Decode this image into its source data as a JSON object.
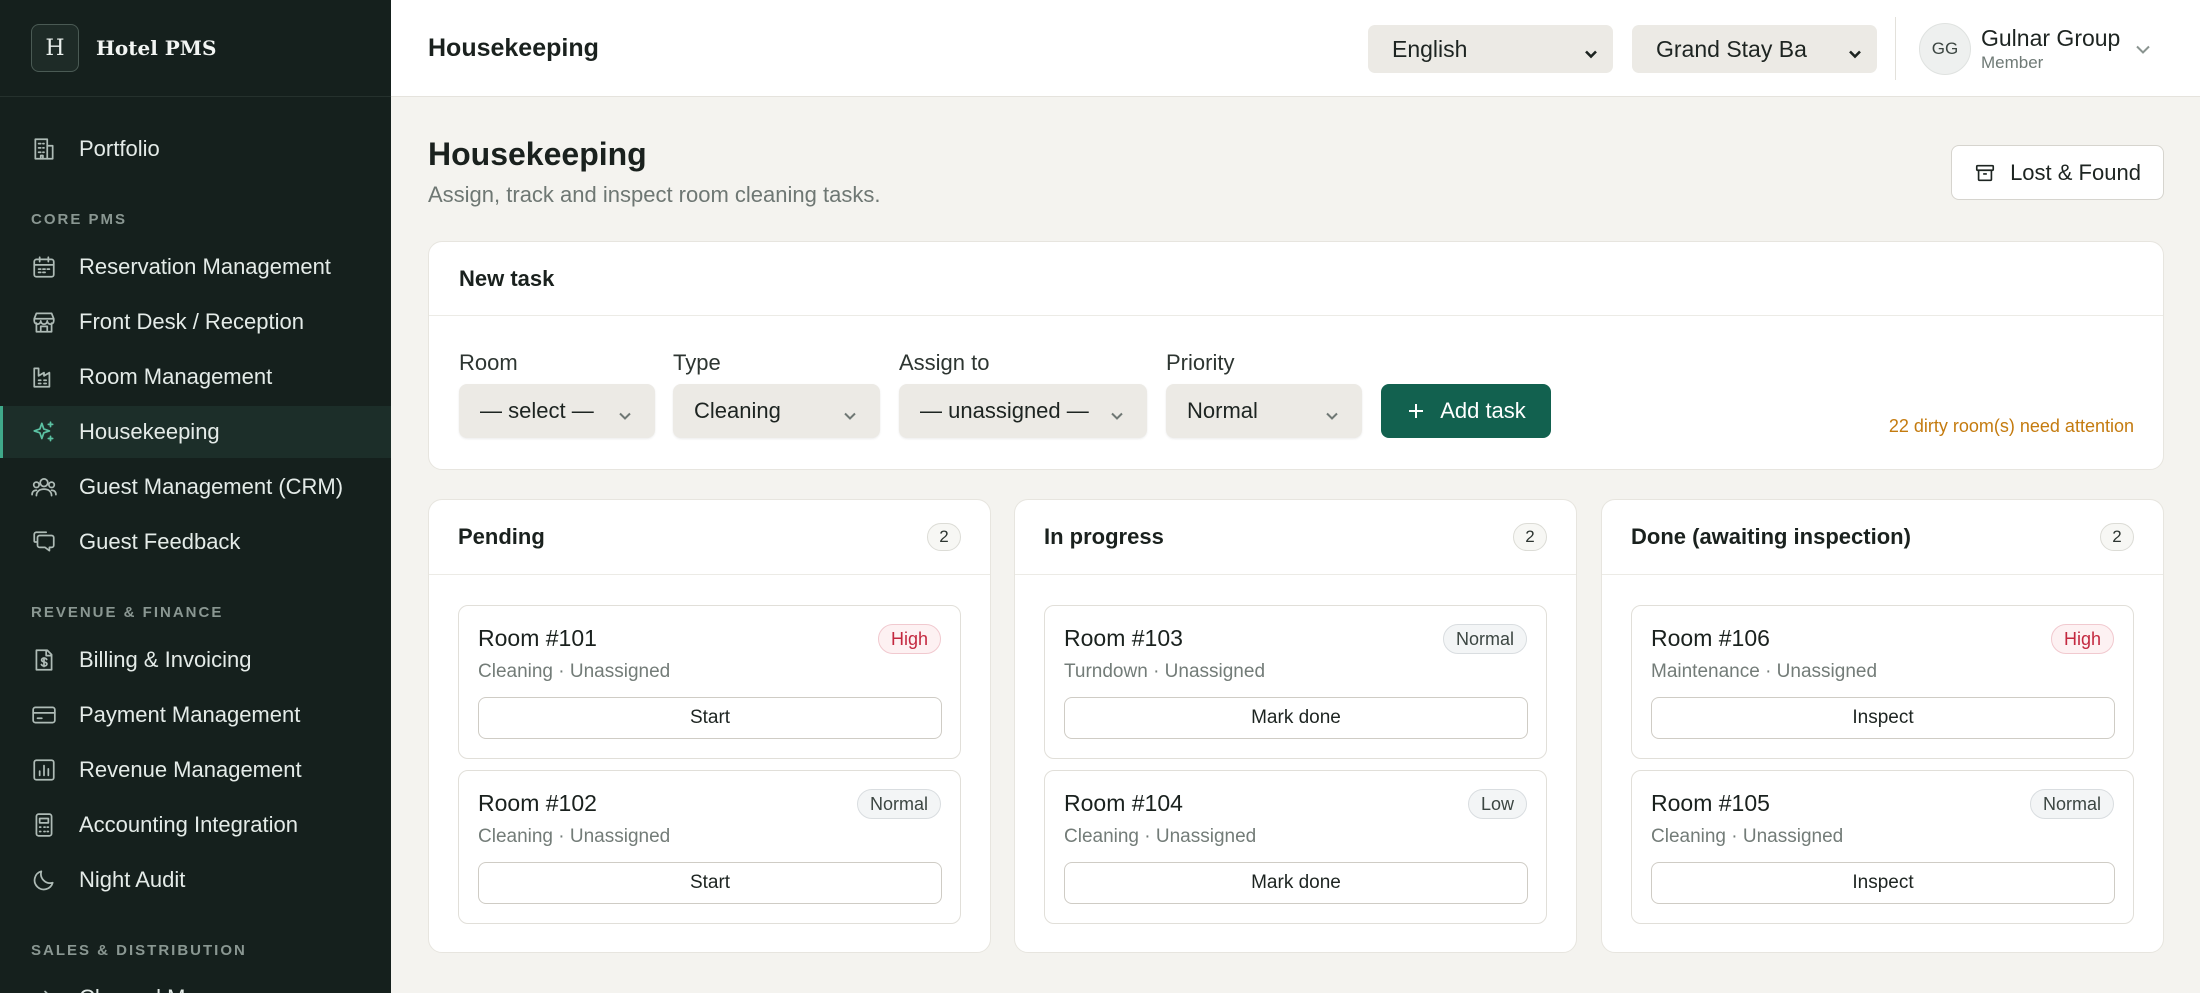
{
  "app": {
    "logo_letter": "H",
    "name": "Hotel PMS"
  },
  "sidebar": {
    "top_item": {
      "label": "Portfolio",
      "icon": "building-icon"
    },
    "sections": [
      {
        "title": "CORE PMS"
      },
      {
        "title": "REVENUE & FINANCE"
      },
      {
        "title": "SALES & DISTRIBUTION"
      }
    ],
    "items": [
      {
        "label": "Reservation Management",
        "icon": "calendar-icon"
      },
      {
        "label": "Front Desk / Reception",
        "icon": "store-icon"
      },
      {
        "label": "Room Management",
        "icon": "factory-icon"
      },
      {
        "label": "Housekeeping",
        "icon": "sparkles-icon",
        "active": true
      },
      {
        "label": "Guest Management (CRM)",
        "icon": "users-icon"
      },
      {
        "label": "Guest Feedback",
        "icon": "message-icon"
      },
      {
        "label": "Billing & Invoicing",
        "icon": "receipt-icon"
      },
      {
        "label": "Payment Management",
        "icon": "credit-card-icon"
      },
      {
        "label": "Revenue Management",
        "icon": "bar-chart-icon"
      },
      {
        "label": "Accounting Integration",
        "icon": "calculator-icon"
      },
      {
        "label": "Night Audit",
        "icon": "moon-icon"
      },
      {
        "label": "Channel Manager",
        "icon": "arrow-icon"
      }
    ]
  },
  "topbar": {
    "title": "Housekeeping",
    "language": "English",
    "property": "Grand Stay Bal",
    "user": {
      "initials": "GG",
      "name": "Gulnar Group",
      "role": "Member"
    }
  },
  "page": {
    "title": "Housekeeping",
    "subtitle": "Assign, track and inspect room cleaning tasks.",
    "lost_found_label": "Lost & Found"
  },
  "new_task": {
    "title": "New task",
    "fields": {
      "room": {
        "label": "Room",
        "value": "— select —"
      },
      "type": {
        "label": "Type",
        "value": "Cleaning"
      },
      "assign": {
        "label": "Assign to",
        "value": "— unassigned —"
      },
      "priority": {
        "label": "Priority",
        "value": "Normal"
      }
    },
    "add_label": "Add task",
    "attention": "22 dirty room(s) need attention"
  },
  "columns": [
    {
      "title": "Pending",
      "count": "2",
      "tasks": [
        {
          "room": "Room #101",
          "meta": "Cleaning · Unassigned",
          "priority": "High",
          "level": "high",
          "action": "Start"
        },
        {
          "room": "Room #102",
          "meta": "Cleaning · Unassigned",
          "priority": "Normal",
          "level": "normal",
          "action": "Start"
        }
      ]
    },
    {
      "title": "In progress",
      "count": "2",
      "tasks": [
        {
          "room": "Room #103",
          "meta": "Turndown · Unassigned",
          "priority": "Normal",
          "level": "normal",
          "action": "Mark done"
        },
        {
          "room": "Room #104",
          "meta": "Cleaning · Unassigned",
          "priority": "Low",
          "level": "low",
          "action": "Mark done"
        }
      ]
    },
    {
      "title": "Done (awaiting inspection)",
      "count": "2",
      "tasks": [
        {
          "room": "Room #106",
          "meta": "Maintenance · Unassigned",
          "priority": "High",
          "level": "high",
          "action": "Inspect"
        },
        {
          "room": "Room #105",
          "meta": "Cleaning · Unassigned",
          "priority": "Normal",
          "level": "normal",
          "action": "Inspect"
        }
      ]
    }
  ],
  "colors": {
    "accent": "#12614f",
    "sidebar_bg": "#15201d",
    "warning": "#c47b0f",
    "high": "#c3283f"
  }
}
